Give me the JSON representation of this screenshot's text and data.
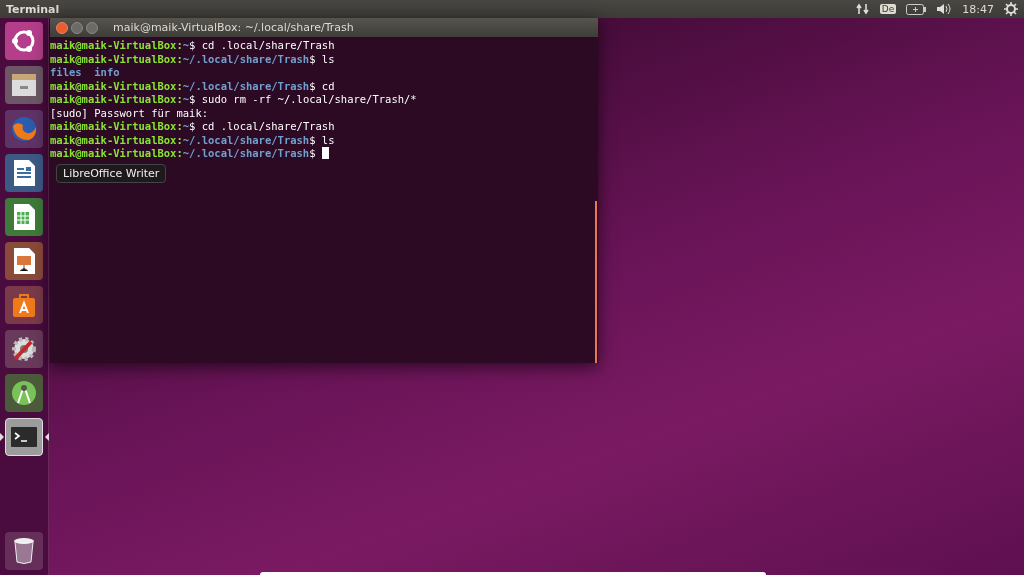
{
  "top_bar": {
    "title": "Terminal",
    "keyboard": "De",
    "clock": "18:47"
  },
  "launcher": [
    {
      "kind": "ubuntu",
      "active": false
    },
    {
      "kind": "files",
      "active": false
    },
    {
      "kind": "firefox",
      "active": false
    },
    {
      "kind": "writer",
      "active": false
    },
    {
      "kind": "calc",
      "active": false
    },
    {
      "kind": "impress",
      "active": false
    },
    {
      "kind": "software",
      "active": false
    },
    {
      "kind": "settings",
      "active": false
    },
    {
      "kind": "android",
      "active": false
    },
    {
      "kind": "terminal",
      "active": true
    }
  ],
  "tooltip": "LibreOffice Writer",
  "terminal": {
    "title": "maik@maik-VirtualBox: ~/.local/share/Trash",
    "lines": [
      {
        "kind": "prompt",
        "user": "maik@maik-VirtualBox:",
        "path": "~",
        "command": "$ cd .local/share/Trash"
      },
      {
        "kind": "prompt",
        "user": "maik@maik-VirtualBox:",
        "path": "~/.local/share/Trash",
        "command": "$ ls"
      },
      {
        "kind": "dirs",
        "text": "files  info"
      },
      {
        "kind": "prompt",
        "user": "maik@maik-VirtualBox:",
        "path": "~/.local/share/Trash",
        "command": "$ cd"
      },
      {
        "kind": "prompt",
        "user": "maik@maik-VirtualBox:",
        "path": "~",
        "command": "$ sudo rm -rf ~/.local/share/Trash/*"
      },
      {
        "kind": "output",
        "text": "[sudo] Passwort für maik:"
      },
      {
        "kind": "prompt",
        "user": "maik@maik-VirtualBox:",
        "path": "~",
        "command": "$ cd .local/share/Trash"
      },
      {
        "kind": "prompt",
        "user": "maik@maik-VirtualBox:",
        "path": "~/.local/share/Trash",
        "command": "$ ls"
      },
      {
        "kind": "prompt",
        "user": "maik@maik-VirtualBox:",
        "path": "~/.local/share/Trash",
        "command": "$",
        "cursor": true
      }
    ]
  }
}
